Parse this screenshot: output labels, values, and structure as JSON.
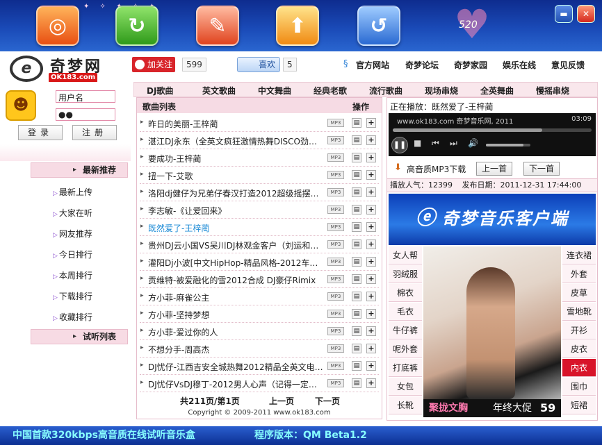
{
  "window": {
    "heart_text": "520",
    "toolbar_icons": [
      "home-icon",
      "refresh-icon",
      "notes-icon",
      "upload-icon",
      "back-icon"
    ],
    "minimize": "▬",
    "close": "✕"
  },
  "header": {
    "logo_name": "奇梦网",
    "logo_url": "OK183.com",
    "weibo_follow": "加关注",
    "weibo_count": "599",
    "like_label": "喜欢",
    "like_count": "5",
    "links": [
      "官方网站",
      "奇梦论坛",
      "奇梦家园",
      "娱乐在线",
      "意见反馈"
    ]
  },
  "login": {
    "username": "用户名",
    "password": "●●",
    "login_btn": "登录",
    "register_btn": "注册"
  },
  "sidebar": {
    "section1": "最新推荐",
    "items": [
      "最新上传",
      "大家在听",
      "网友推荐",
      "今日排行",
      "本周排行",
      "下载排行",
      "收藏排行"
    ],
    "section2": "试听列表"
  },
  "categories": [
    "DJ歌曲",
    "英文歌曲",
    "中文舞曲",
    "经典老歌",
    "流行歌曲",
    "现场串烧",
    "全英舞曲",
    "慢摇串烧"
  ],
  "songlist": {
    "col_title": "歌曲列表",
    "col_ops": "操作",
    "mp3_label": "MP3",
    "songs": [
      "昨日的美丽-王梓蔺",
      "湛江DJ永东（全英文疯狂激情热舞DISCO劲爆…",
      "要成功-王梓蔺",
      "扭一下-艾歌",
      "洛阳dj健仔为兄弟仔春汉打造2012超级摇摆…",
      "李志敏-《让爱回来》",
      "既然爱了-王梓蔺",
      "贵州DJ云小国VS吴川DJ林观金客户（刘运和…",
      "灌阳Dj小波[中文HipHop-精品风格-2012车载…",
      "贡维特-被爱融化的雪2012合成 DJ豪仔Rimix",
      "方小菲-麻雀公主",
      "方小菲-坚持梦想",
      "方小菲-爱过你的人",
      "不想分手-周高杰",
      "DJ忧仔-江西吉安全城热舞2012精品全英文电…",
      "DJ忧仔VsDJ穆丁-2012男人心声（记得一定要…"
    ],
    "active_index": 6,
    "pages": "共211页/第1页",
    "prev": "上一页",
    "next": "下一页",
    "copyright": "Copyright © 2009-2011 www.ok183.com"
  },
  "player": {
    "now_playing": "正在播放：既然爱了-王梓蔺",
    "url_text": "www.ok183.com 奇梦音乐网, 2011",
    "time": "03:09",
    "progress": 0.75,
    "volume": 0.85,
    "download": "高音质MP3下载",
    "prev_btn": "上一首",
    "next_btn": "下一首",
    "popularity": "播放人气：12399",
    "date": "发布日期：2011-12-31 17:44:00"
  },
  "ad": {
    "banner": "奇梦音乐客户端",
    "left_tags": [
      "女人帮",
      "羽绒服",
      "棉衣",
      "毛衣",
      "牛仔裤",
      "呢外套",
      "打底裤",
      "女包",
      "长靴"
    ],
    "right_tags": [
      "连衣裙",
      "外套",
      "皮草",
      "雪地靴",
      "开衫",
      "皮衣",
      "内衣",
      "围巾",
      "短裙"
    ],
    "hot_tag_index": 6,
    "cap1": "聚拢文胸",
    "cap2": "年终大促",
    "cap3": "59"
  },
  "footer": {
    "left": "中国首款320kbps高音质在线试听音乐盒",
    "right": "程序版本：QM Beta1.2"
  },
  "colors": {
    "topbar": "#1a4ab7",
    "accent_pink": "#f6dbe4",
    "link_active": "#1c8bd6",
    "hot_tag": "#d8142a"
  }
}
